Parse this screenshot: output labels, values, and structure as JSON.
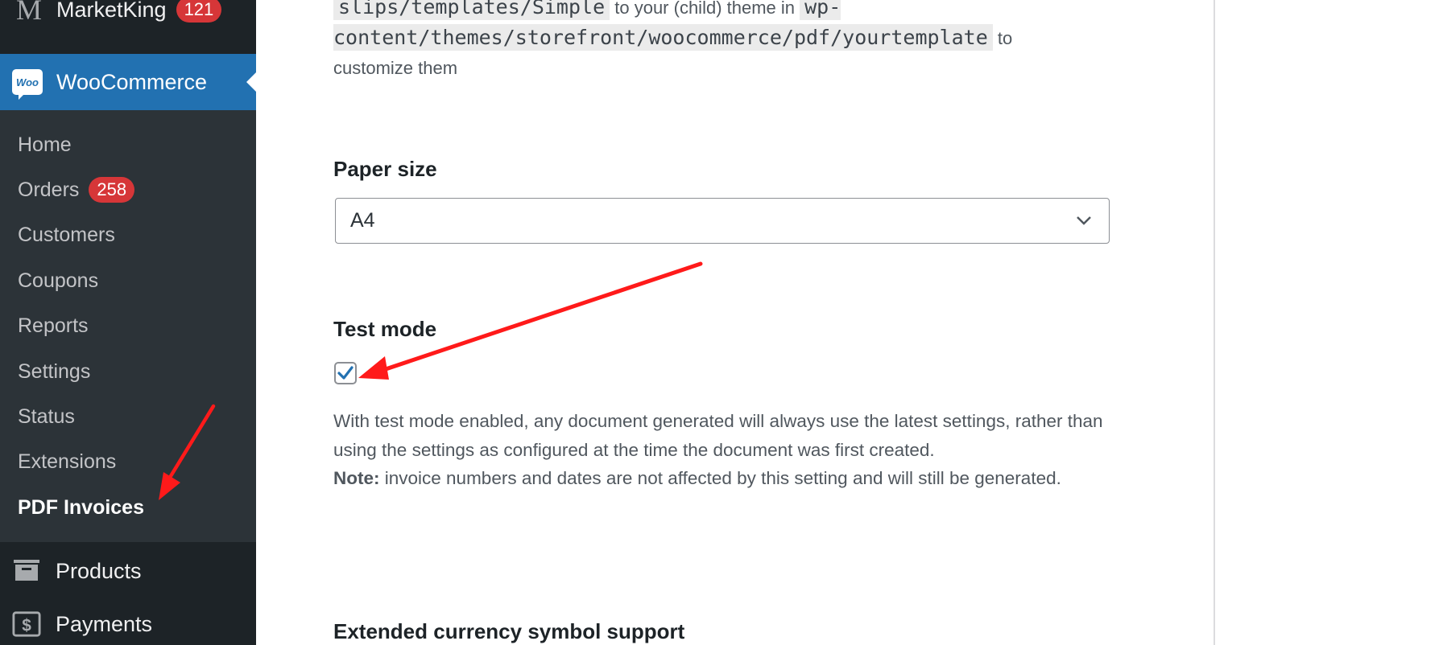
{
  "sidebar": {
    "marketking": {
      "label": "MarketKing",
      "badge": "121",
      "icon": "marketking-logo-icon"
    },
    "woocommerce": {
      "label": "WooCommerce",
      "icon_text": "Woo",
      "icon": "woocommerce-logo-icon"
    },
    "submenu": [
      {
        "label": "Home"
      },
      {
        "label": "Orders",
        "badge": "258"
      },
      {
        "label": "Customers"
      },
      {
        "label": "Coupons"
      },
      {
        "label": "Reports"
      },
      {
        "label": "Settings"
      },
      {
        "label": "Status"
      },
      {
        "label": "Extensions"
      },
      {
        "label": "PDF Invoices",
        "current": true
      }
    ],
    "products": {
      "label": "Products",
      "icon": "archive-box-icon"
    },
    "payments": {
      "label": "Payments",
      "icon": "dollar-icon"
    }
  },
  "content": {
    "intro": {
      "code1": "slips/templates/Simple",
      "text1": " to your (child) theme in ",
      "code2": "wp-content/themes/storefront/woocommerce/pdf/yourtemplate",
      "text2": " to customize them"
    },
    "paper_size": {
      "label": "Paper size",
      "value": "A4"
    },
    "test_mode": {
      "label": "Test mode",
      "checked": true,
      "description": "With test mode enabled, any document generated will always use the latest settings, rather than using the settings as configured at the time the document was first created.",
      "note_label": "Note:",
      "note_text": " invoice numbers and dates are not affected by this setting and will still be generated."
    },
    "extended_currency": {
      "label": "Extended currency symbol support"
    }
  },
  "colors": {
    "accent": "#2271b1",
    "badge": "#d63638",
    "annotation_arrow": "#ff1a1a",
    "sidebar_bg": "#1d2327",
    "submenu_bg": "#2c3338"
  }
}
